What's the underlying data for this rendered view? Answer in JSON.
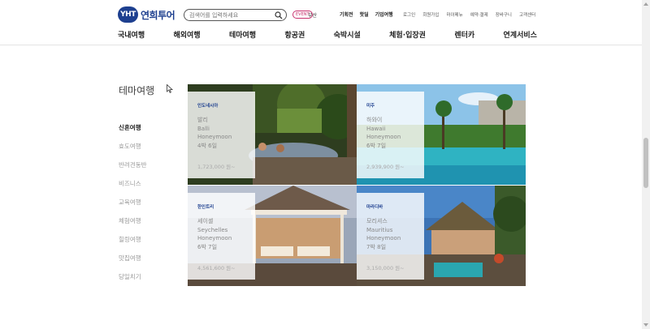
{
  "header": {
    "logo_mark": "YHT",
    "logo_text": "연희투어",
    "search_placeholder": "검색어를 입력하세요",
    "badge": "EVENT",
    "badge_text": "부산",
    "top_links": [
      "기획전",
      "핫딜",
      "기업여행"
    ],
    "util_links": [
      "로그인",
      "회원가입",
      "마이메뉴",
      "예약·결제",
      "장바구니",
      "고객센터"
    ],
    "gnb": [
      "국내여행",
      "해외여행",
      "테마여행",
      "항공권",
      "숙박시설",
      "체험·입장권",
      "렌터카",
      "연계서비스"
    ]
  },
  "side": {
    "title": "테마여행",
    "items": [
      "신혼여행",
      "효도여행",
      "반려견동반",
      "비즈니스",
      "교육여행",
      "체험여행",
      "힐링여행",
      "맛집여행",
      "당일치기"
    ],
    "active_index": 0
  },
  "tiles": [
    {
      "region": "인도네시아",
      "lines": [
        "발리",
        "Balli",
        "Honeymoon",
        "4박 6일"
      ],
      "price": "1,723,000 원~"
    },
    {
      "region": "미주",
      "lines": [
        "하와이",
        "Hawaii",
        "Honeymoon",
        "6박 7일"
      ],
      "price": "2,939,900 원~"
    },
    {
      "region": "한인트리",
      "lines": [
        "세이셸",
        "Seychelles",
        "Honeymoon",
        "6박 7일"
      ],
      "price": "4,561,600 원~"
    },
    {
      "region": "마라디바",
      "lines": [
        "모리셔스",
        "Mauritius",
        "Honeymoon",
        "7박 8일"
      ],
      "price": "3,150,000 원~"
    }
  ]
}
